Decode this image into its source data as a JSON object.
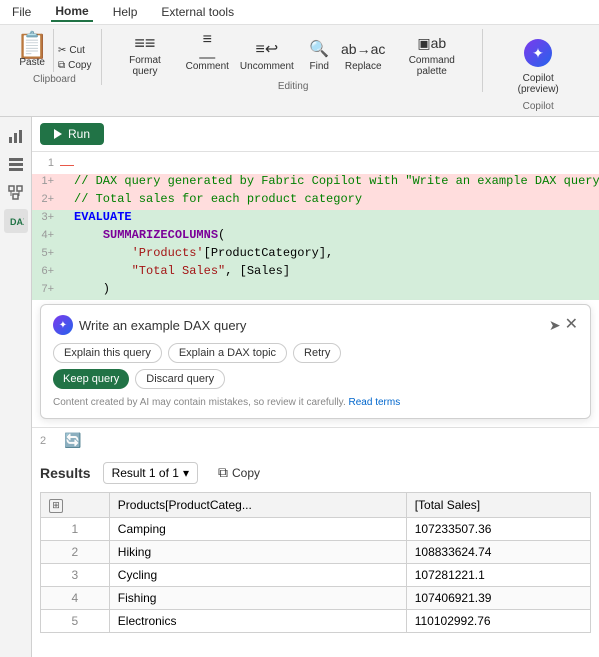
{
  "menu": {
    "items": [
      "File",
      "Home",
      "Help",
      "External tools"
    ],
    "active": "Home"
  },
  "ribbon": {
    "clipboard": {
      "paste_label": "Paste",
      "cut_label": "Cut",
      "copy_label": "Copy",
      "group_label": "Clipboard"
    },
    "editing": {
      "group_label": "Editing",
      "buttons": [
        "Format query",
        "Comment",
        "Uncomment",
        "Find",
        "Replace",
        "Command palette"
      ]
    },
    "copilot": {
      "label": "Copilot (preview)",
      "group_label": "Copilot"
    }
  },
  "run_btn": "Run",
  "code": {
    "line1": "1",
    "lines": [
      {
        "num": "1+",
        "bg": "red",
        "text": "// DAX query generated by Fabric Copilot with \"Write an example DAX query\""
      },
      {
        "num": "2+",
        "bg": "red",
        "text": "// Total sales for each product category"
      },
      {
        "num": "3+",
        "bg": "green",
        "text": "EVALUATE"
      },
      {
        "num": "4+",
        "bg": "green",
        "text": "    SUMMARIZECOLUMNS("
      },
      {
        "num": "5+",
        "bg": "green",
        "text": "        'Products'[ProductCategory],"
      },
      {
        "num": "6+",
        "bg": "green",
        "text": "        \"Total Sales\", [Sales]"
      },
      {
        "num": "7+",
        "bg": "green",
        "text": "    )"
      }
    ]
  },
  "copilot": {
    "logo_text": "✦",
    "title": "Write an example DAX query",
    "btn_explain_query": "Explain this query",
    "btn_explain_dax": "Explain a DAX topic",
    "btn_retry": "Retry",
    "btn_keep": "Keep query",
    "btn_discard": "Discard query",
    "footer": "Content created by AI may contain mistakes, so review it carefully.",
    "read_terms": "Read terms"
  },
  "results": {
    "title": "Results",
    "result_label": "Result 1 of 1",
    "copy_label": "Copy",
    "columns": [
      "",
      "Products[ProductCateg...",
      "[Total Sales]"
    ],
    "rows": [
      {
        "num": "1",
        "category": "Camping",
        "sales": "107233507.36"
      },
      {
        "num": "2",
        "category": "Hiking",
        "sales": "108833624.74"
      },
      {
        "num": "3",
        "category": "Cycling",
        "sales": "107281221.1"
      },
      {
        "num": "4",
        "category": "Fishing",
        "sales": "107406921.39"
      },
      {
        "num": "5",
        "category": "Electronics",
        "sales": "110102992.76"
      }
    ]
  }
}
